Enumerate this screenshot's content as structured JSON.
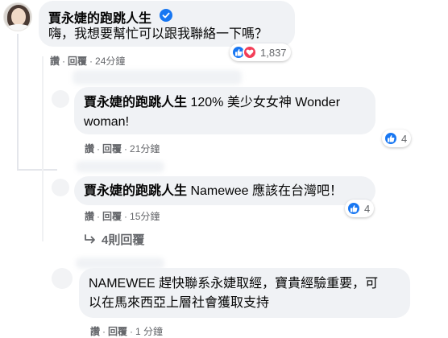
{
  "comments": [
    {
      "author": "賈永婕的跑跳人生",
      "text": "嗨，我想要幫忙可以跟我聯絡一下嗎？",
      "actions": {
        "read": "讚",
        "reply": "回覆",
        "time": "24分鐘"
      },
      "reaction_count": "1,837"
    }
  ],
  "replies": [
    {
      "author": "賈永婕的跑跳人生",
      "text_line1": "120% 美少女女神 Wonder",
      "text_line2": "woman!",
      "actions": {
        "read": "讚",
        "reply": "回覆",
        "time": "21分鐘"
      },
      "reaction_count": "4"
    },
    {
      "author": "賈永婕的跑跳人生",
      "text": "Namewee 應該在台灣吧！",
      "actions": {
        "read": "讚",
        "reply": "回覆",
        "time": "15分鐘"
      },
      "reaction_count": "4"
    }
  ],
  "more_replies": "4則回覆",
  "comment2": {
    "text_line1": "NAMEWEE 趕快聯系永婕取經，寶貴經驗重要，可",
    "text_line2": "以在馬來西亞上層社會獲取支持",
    "actions": {
      "read": "讚",
      "reply": "回覆",
      "time": "1 分鐘"
    }
  },
  "separator": "·",
  "colors": {
    "like": "#1877f2",
    "love": "#f33e58",
    "bubble": "#f0f2f5",
    "meta": "#65676b"
  }
}
